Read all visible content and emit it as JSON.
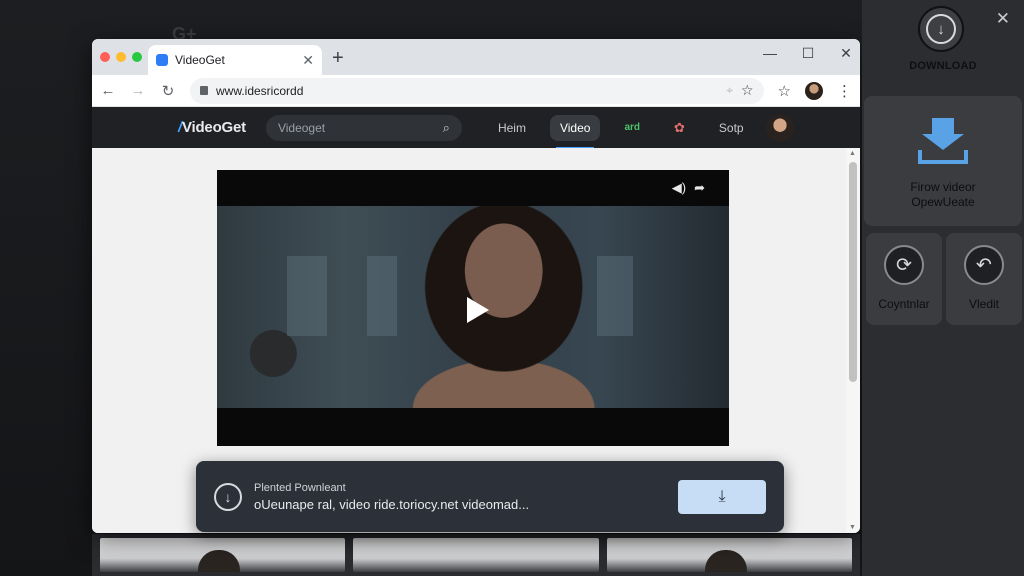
{
  "browser": {
    "tab_title": "VideoGet",
    "url": "www.idesricordd",
    "window_controls": [
      "minimize",
      "maximize",
      "close"
    ]
  },
  "site": {
    "logo_main": "VideoGet",
    "search_placeholder": "Videoget",
    "nav": {
      "item1": "Heim",
      "item2": "Video",
      "item3": "ard",
      "item5": "Sotp"
    }
  },
  "toast": {
    "title": "Plented Pownleant",
    "filename": "oUeunape ral, video ride.toriocy.net videomad..."
  },
  "panel": {
    "download_label": "DOWNLOAD",
    "main_card_line1": "Firow videor",
    "main_card_line2": "OpewUeate",
    "small_card_1": "Coyntnlar",
    "small_card_2": "Vledit"
  },
  "colors": {
    "accent": "#47a3ff",
    "panel_bg": "#2b2d30",
    "download_blue": "#5aa2e6",
    "toast_bg": "#2c3038"
  },
  "icons": {
    "ghost": "G+"
  }
}
